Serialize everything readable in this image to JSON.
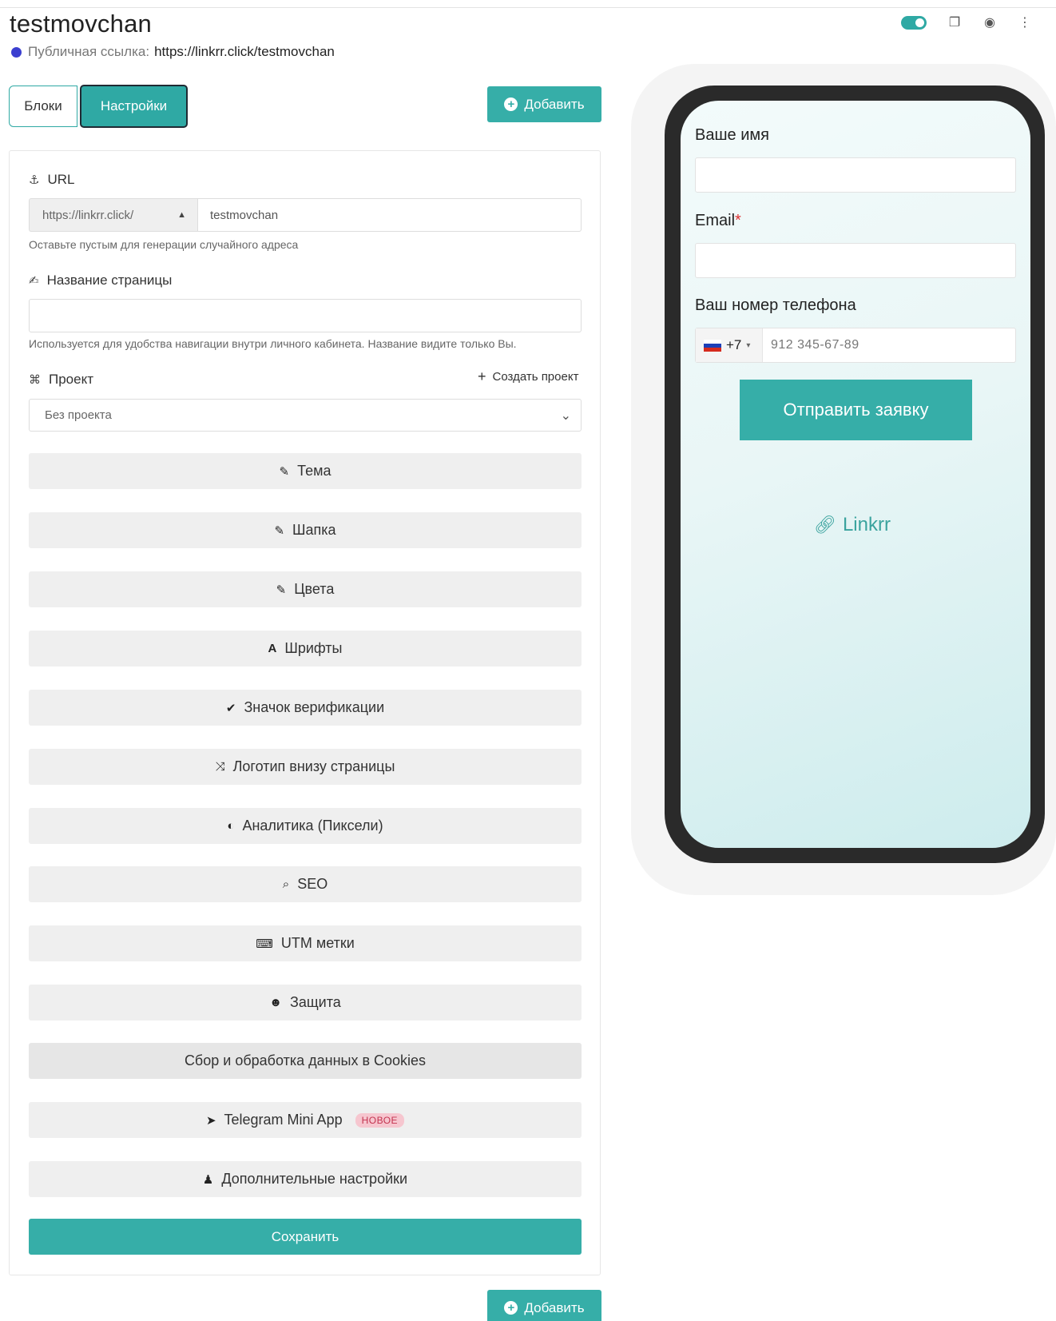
{
  "header": {
    "title": "testmovchan",
    "public_link_label": "Публичная ссылка:",
    "public_link_url": "https://linkrr.click/testmovchan",
    "dot_color": "#3b3fd0",
    "actions": [
      "toggle",
      "copy-icon",
      "eye-icon",
      "more-vertical-icon"
    ]
  },
  "tabs": {
    "blocks": "Блоки",
    "settings": "Настройки"
  },
  "add_button": {
    "label": "Добавить"
  },
  "settings": {
    "url_label": "URL",
    "url_prefix": "https://linkrr.click/",
    "url_value": "testmovchan",
    "url_hint": "Оставьте пустым для генерации случайного адреса",
    "page_name_label": "Название страницы",
    "page_name_value": "",
    "page_name_hint": "Используется для удобства навигации внутри личного кабинета. Название видите только Вы.",
    "project_label": "Проект",
    "create_project": "Создать проект",
    "project_value": "Без проекта",
    "buttons": {
      "theme": "Тема",
      "header": "Шапка",
      "colors": "Цвета",
      "fonts": "Шрифты",
      "verification": "Значок верификации",
      "footer_logo": "Логотип внизу страницы",
      "analytics": "Аналитика (Пиксели)",
      "seo": "SEO",
      "utm": "UTM метки",
      "protection": "Защита",
      "cookies": "Сбор и обработка данных в Cookies",
      "telegram": "Telegram Mini App",
      "telegram_badge": "НОВОЕ",
      "advanced": "Дополнительные настройки"
    },
    "save": "Сохранить"
  },
  "preview": {
    "name_label": "Ваше имя",
    "email_label": "Email",
    "email_required": "*",
    "phone_label": "Ваш номер телефона",
    "phone_code": "+7",
    "phone_placeholder": "912 345-67-89",
    "submit": "Отправить заявку",
    "brand": "Linkrr"
  },
  "colors": {
    "accent": "#36aea8",
    "badge_bg": "#f6c6cf",
    "badge_text": "#c3334f"
  }
}
